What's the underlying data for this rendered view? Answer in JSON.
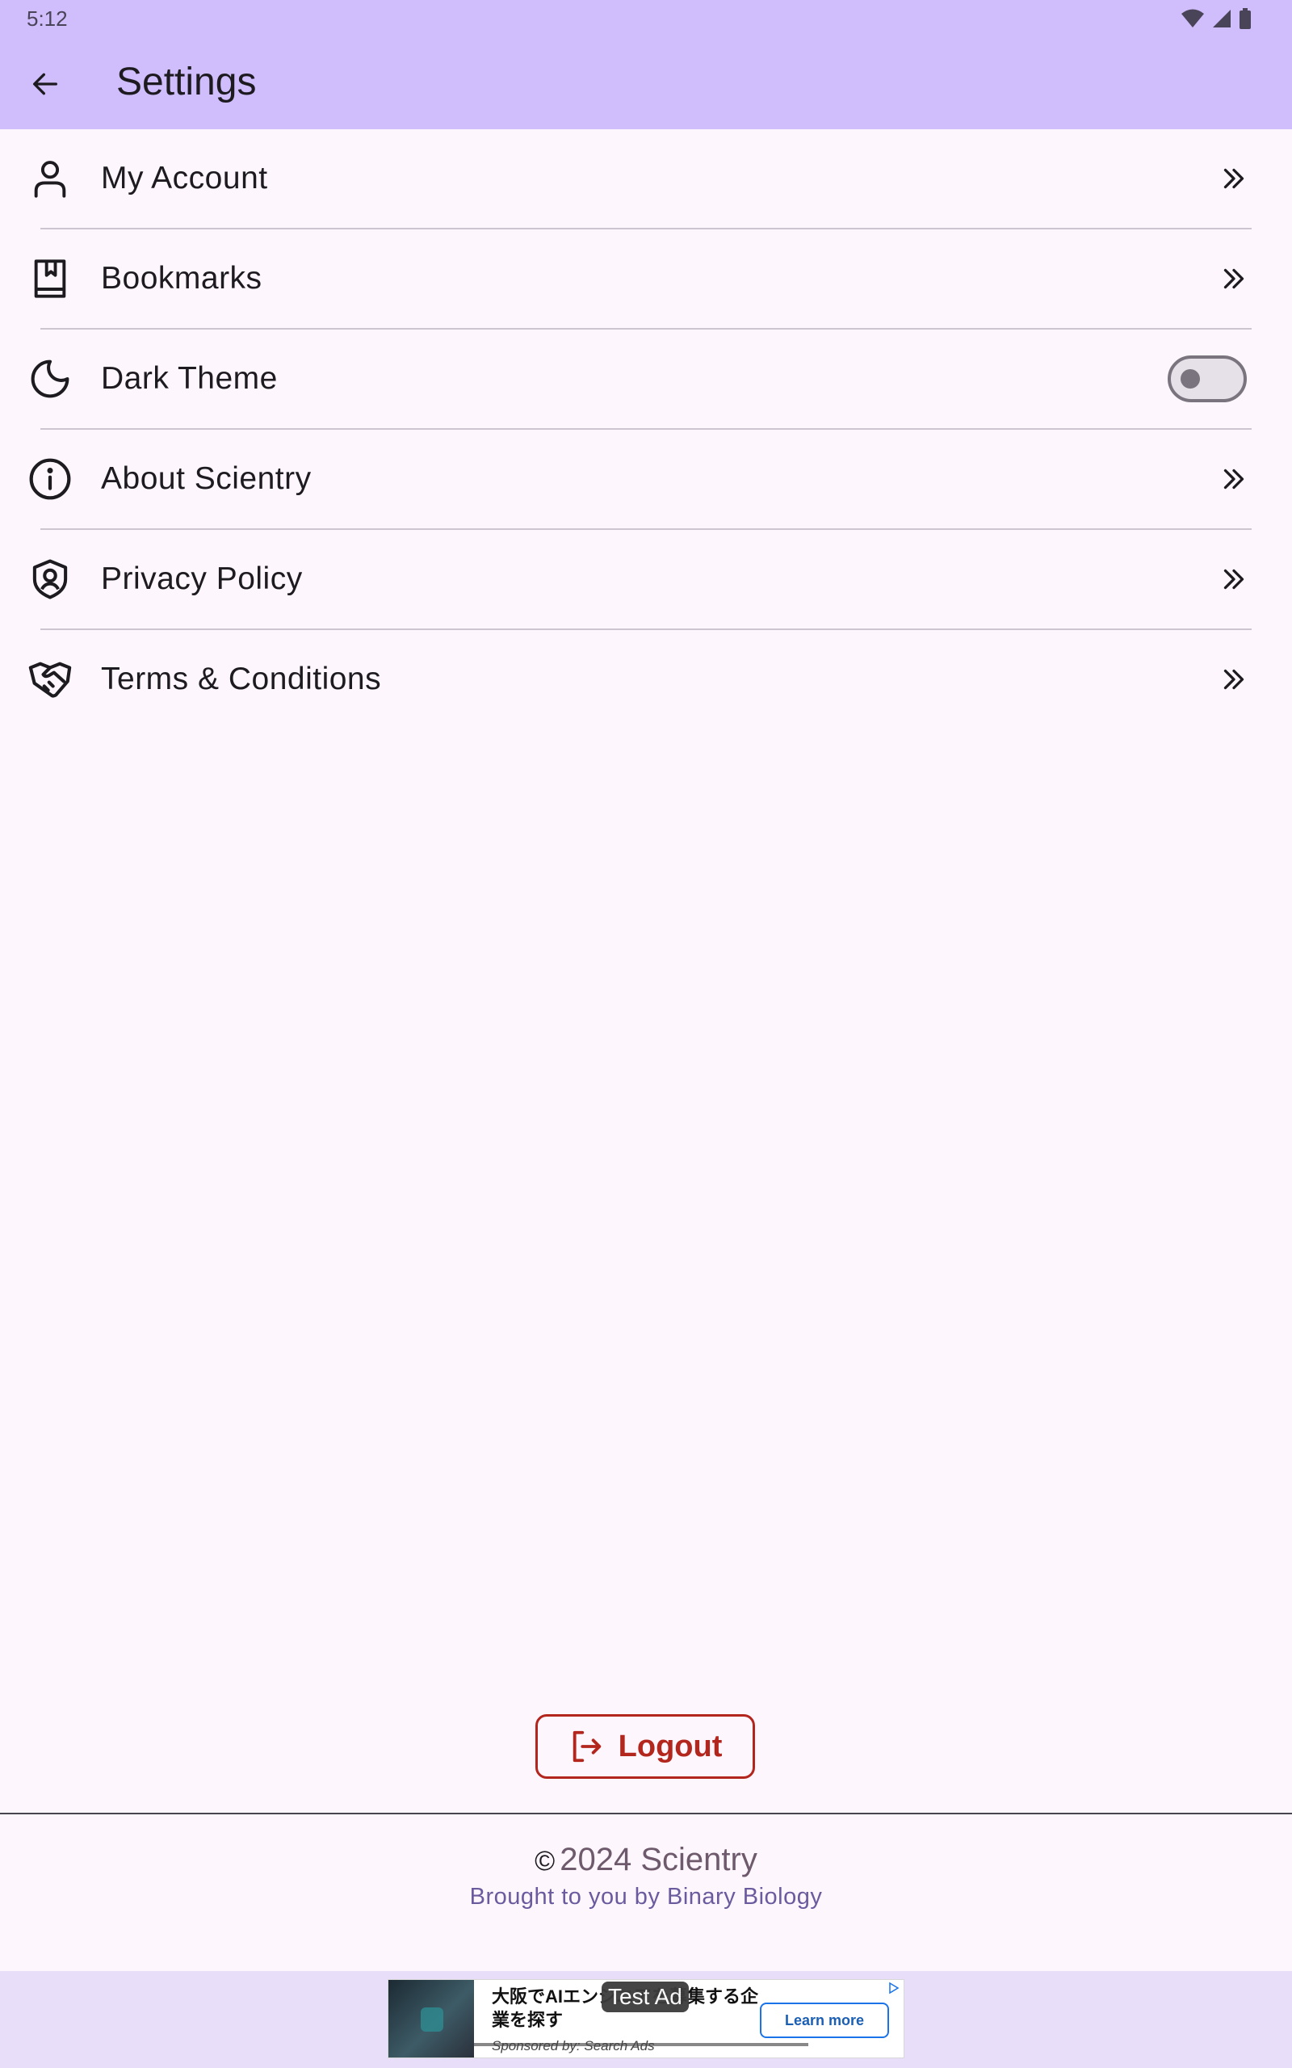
{
  "status_bar": {
    "time": "5:12",
    "icons": [
      "wifi-icon",
      "signal-icon",
      "battery-icon"
    ]
  },
  "app_bar": {
    "title": "Settings",
    "back_icon": "arrow-left-icon",
    "background": "#d0bdfc"
  },
  "settings": {
    "items": [
      {
        "label": "My Account",
        "icon": "user-icon",
        "trailing": "chevrons-right-icon"
      },
      {
        "label": "Bookmarks",
        "icon": "bookmark-book-icon",
        "trailing": "chevrons-right-icon"
      },
      {
        "label": "Dark Theme",
        "icon": "moon-icon",
        "trailing": "toggle",
        "toggle_on": false
      },
      {
        "label": "About Scientry",
        "icon": "info-icon",
        "trailing": "chevrons-right-icon"
      },
      {
        "label": "Privacy Policy",
        "icon": "shield-user-icon",
        "trailing": "chevrons-right-icon"
      },
      {
        "label": "Terms & Conditions",
        "icon": "handshake-icon",
        "trailing": "chevrons-right-icon"
      }
    ]
  },
  "logout": {
    "label": "Logout",
    "icon": "logout-icon",
    "color": "#b3261e"
  },
  "footer": {
    "copyright_symbol": "©",
    "copyright": "2024 Scientry",
    "tagline": "Brought to you by Binary Biology"
  },
  "ad": {
    "badge": "Test Ad",
    "headline": "大阪でAIエンジニアを募集する企業を探す",
    "sponsored": "Sponsored by: Search Ads",
    "cta": "Learn more"
  }
}
